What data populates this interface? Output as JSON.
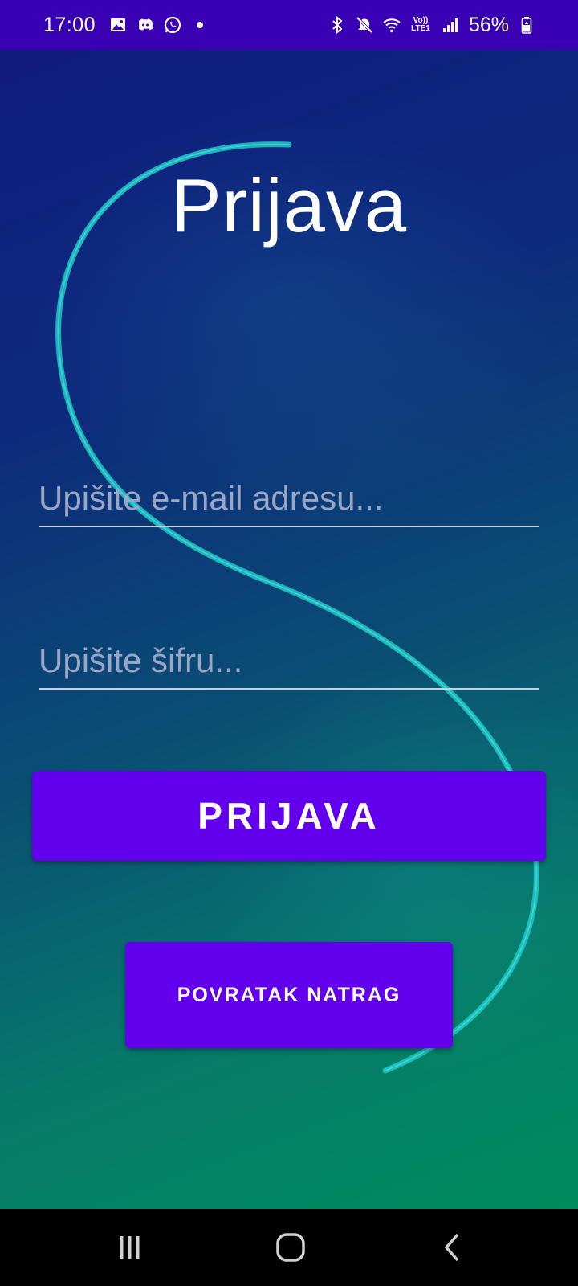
{
  "status_bar": {
    "time": "17:00",
    "battery": "56%",
    "network": "LTE1",
    "volte": "Vo))",
    "icons_left": [
      "gallery-icon",
      "discord-icon",
      "whatsapp-icon",
      "dot-icon"
    ],
    "icons_right": [
      "bluetooth-icon",
      "mute-icon",
      "wifi-icon",
      "volte-icon",
      "signal-icon",
      "battery-icon"
    ],
    "color": "#3a00b4"
  },
  "login": {
    "title": "Prijava",
    "email_placeholder": "Upišite e-mail adresu...",
    "email_value": "",
    "password_placeholder": "Upišite šifru...",
    "password_value": "",
    "login_button": "PRIJAVA",
    "back_button": "POVRATAK NATRAG"
  },
  "colors": {
    "button": "#6200ee",
    "gradient_top": "#101c7e",
    "gradient_bottom": "#008c5c",
    "curve": "#1ec8c8"
  },
  "nav_bar": {
    "buttons": [
      "recents-icon",
      "home-icon",
      "back-icon"
    ]
  }
}
